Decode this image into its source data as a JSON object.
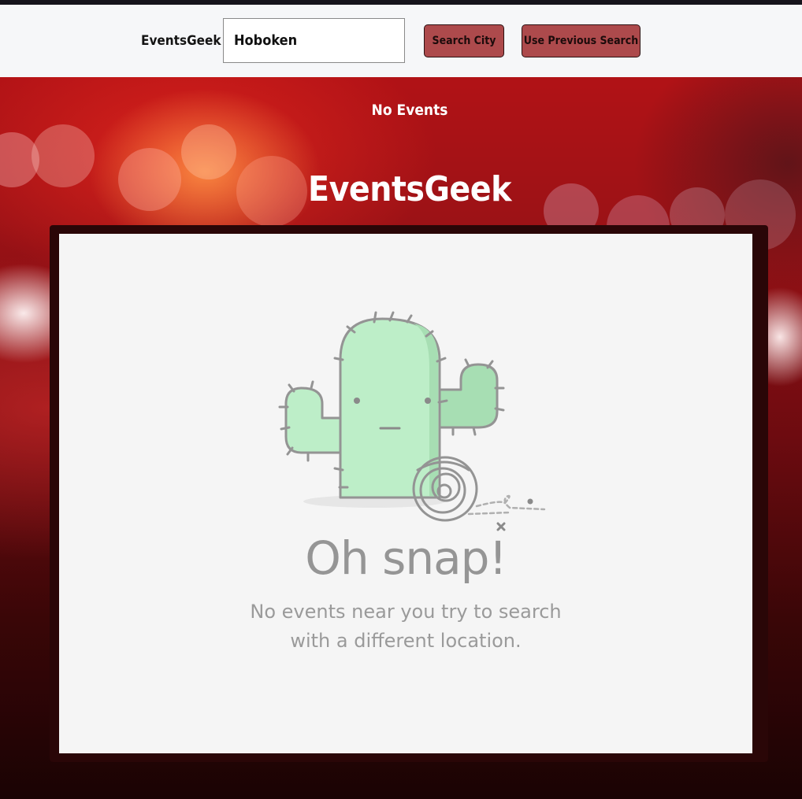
{
  "navbar": {
    "brand": "EventsGeek",
    "search_value": "Hoboken",
    "search_button": "Search City",
    "previous_button": "Use Previous Search"
  },
  "hero": {
    "status": "No Events",
    "title": "EventsGeek"
  },
  "empty_state": {
    "illustration": "cactus-icon",
    "headline": "Oh snap!",
    "message_line1": "No events near you try to search",
    "message_line2": "with a different location."
  },
  "colors": {
    "button_bg": "#ad4a4c",
    "panel_border": "#2a0607",
    "cactus_green": "#bdeec8"
  }
}
